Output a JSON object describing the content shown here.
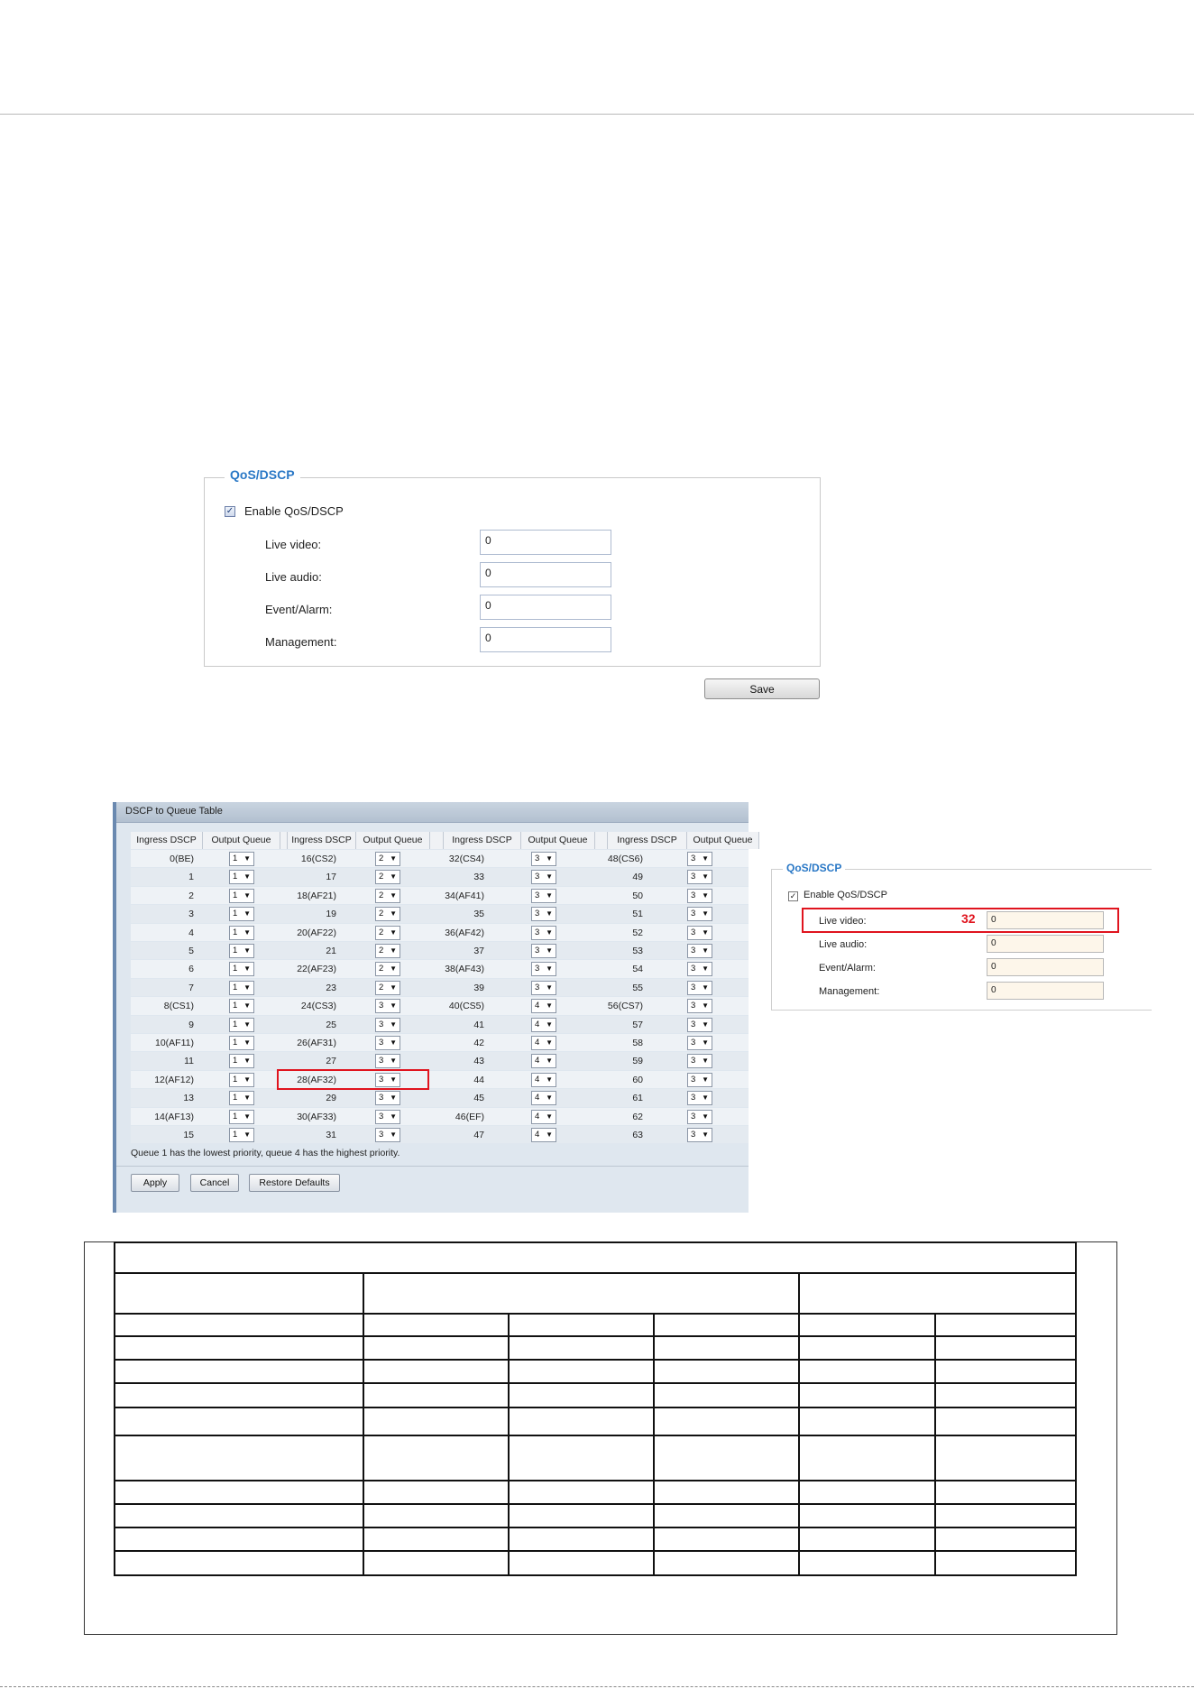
{
  "qos_panel": {
    "legend": "QoS/DSCP",
    "enable_label": "Enable QoS/DSCP",
    "enable_checked": true,
    "fields": [
      {
        "label": "Live video:",
        "value": "0"
      },
      {
        "label": "Live audio:",
        "value": "0"
      },
      {
        "label": "Event/Alarm:",
        "value": "0"
      },
      {
        "label": "Management:",
        "value": "0"
      }
    ],
    "save_label": "Save"
  },
  "dscp_table": {
    "title": "DSCP to Queue Table",
    "headers": [
      "Ingress DSCP",
      "Output Queue",
      "Ingress DSCP",
      "Output Queue",
      "Ingress DSCP",
      "Output Queue",
      "Ingress DSCP",
      "Output Queue"
    ],
    "rows": [
      [
        "0(BE)",
        "1",
        "16(CS2)",
        "2",
        "32(CS4)",
        "3",
        "48(CS6)",
        "3"
      ],
      [
        "1",
        "1",
        "17",
        "2",
        "33",
        "3",
        "49",
        "3"
      ],
      [
        "2",
        "1",
        "18(AF21)",
        "2",
        "34(AF41)",
        "3",
        "50",
        "3"
      ],
      [
        "3",
        "1",
        "19",
        "2",
        "35",
        "3",
        "51",
        "3"
      ],
      [
        "4",
        "1",
        "20(AF22)",
        "2",
        "36(AF42)",
        "3",
        "52",
        "3"
      ],
      [
        "5",
        "1",
        "21",
        "2",
        "37",
        "3",
        "53",
        "3"
      ],
      [
        "6",
        "1",
        "22(AF23)",
        "2",
        "38(AF43)",
        "3",
        "54",
        "3"
      ],
      [
        "7",
        "1",
        "23",
        "2",
        "39",
        "3",
        "55",
        "3"
      ],
      [
        "8(CS1)",
        "1",
        "24(CS3)",
        "3",
        "40(CS5)",
        "4",
        "56(CS7)",
        "3"
      ],
      [
        "9",
        "1",
        "25",
        "3",
        "41",
        "4",
        "57",
        "3"
      ],
      [
        "10(AF11)",
        "1",
        "26(AF31)",
        "3",
        "42",
        "4",
        "58",
        "3"
      ],
      [
        "11",
        "1",
        "27",
        "3",
        "43",
        "4",
        "59",
        "3"
      ],
      [
        "12(AF12)",
        "1",
        "28(AF32)",
        "3",
        "44",
        "4",
        "60",
        "3"
      ],
      [
        "13",
        "1",
        "29",
        "3",
        "45",
        "4",
        "61",
        "3"
      ],
      [
        "14(AF13)",
        "1",
        "30(AF33)",
        "3",
        "46(EF)",
        "4",
        "62",
        "3"
      ],
      [
        "15",
        "1",
        "31",
        "3",
        "47",
        "4",
        "63",
        "3"
      ]
    ],
    "note": "Queue 1 has the lowest priority, queue 4 has the highest priority.",
    "buttons": {
      "apply": "Apply",
      "cancel": "Cancel",
      "restore": "Restore Defaults"
    },
    "highlight_color": "#e0141e"
  },
  "qos_panel_small": {
    "legend": "QoS/DSCP",
    "enable_label": "Enable QoS/DSCP",
    "enable_checked": true,
    "fields": [
      {
        "label": "Live video:",
        "value": "0"
      },
      {
        "label": "Live audio:",
        "value": "0"
      },
      {
        "label": "Event/Alarm:",
        "value": "0"
      },
      {
        "label": "Management:",
        "value": "0"
      }
    ],
    "callout_value": "32"
  }
}
